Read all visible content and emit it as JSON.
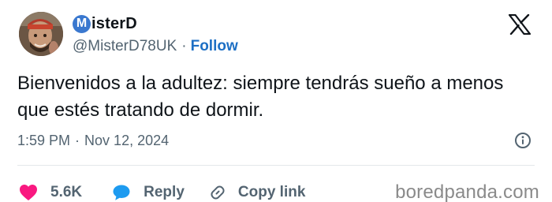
{
  "author": {
    "display_name": "MisterD",
    "name_badge_letter": "M",
    "handle": "@MisterD78UK",
    "follow_label": "Follow",
    "separator": "·",
    "badge_color": "#3a78cf",
    "follow_color": "#1d6fc4"
  },
  "tweet": {
    "text": "Bienvenidos a la adultez: siempre tendrás sueño a menos que estés tratando de dormir.",
    "time": "1:59 PM",
    "date": "Nov 12, 2024",
    "separator": "·"
  },
  "actions": {
    "like_count": "5.6K",
    "reply_label": "Reply",
    "copy_link_label": "Copy link",
    "like_color": "#f91880",
    "reply_color": "#1d9bf0"
  },
  "icons": {
    "platform": "x-logo-icon",
    "info": "info-icon",
    "like": "heart-icon",
    "reply": "speech-bubble-icon",
    "copy_link": "link-icon"
  },
  "watermark": "boredpanda.com"
}
